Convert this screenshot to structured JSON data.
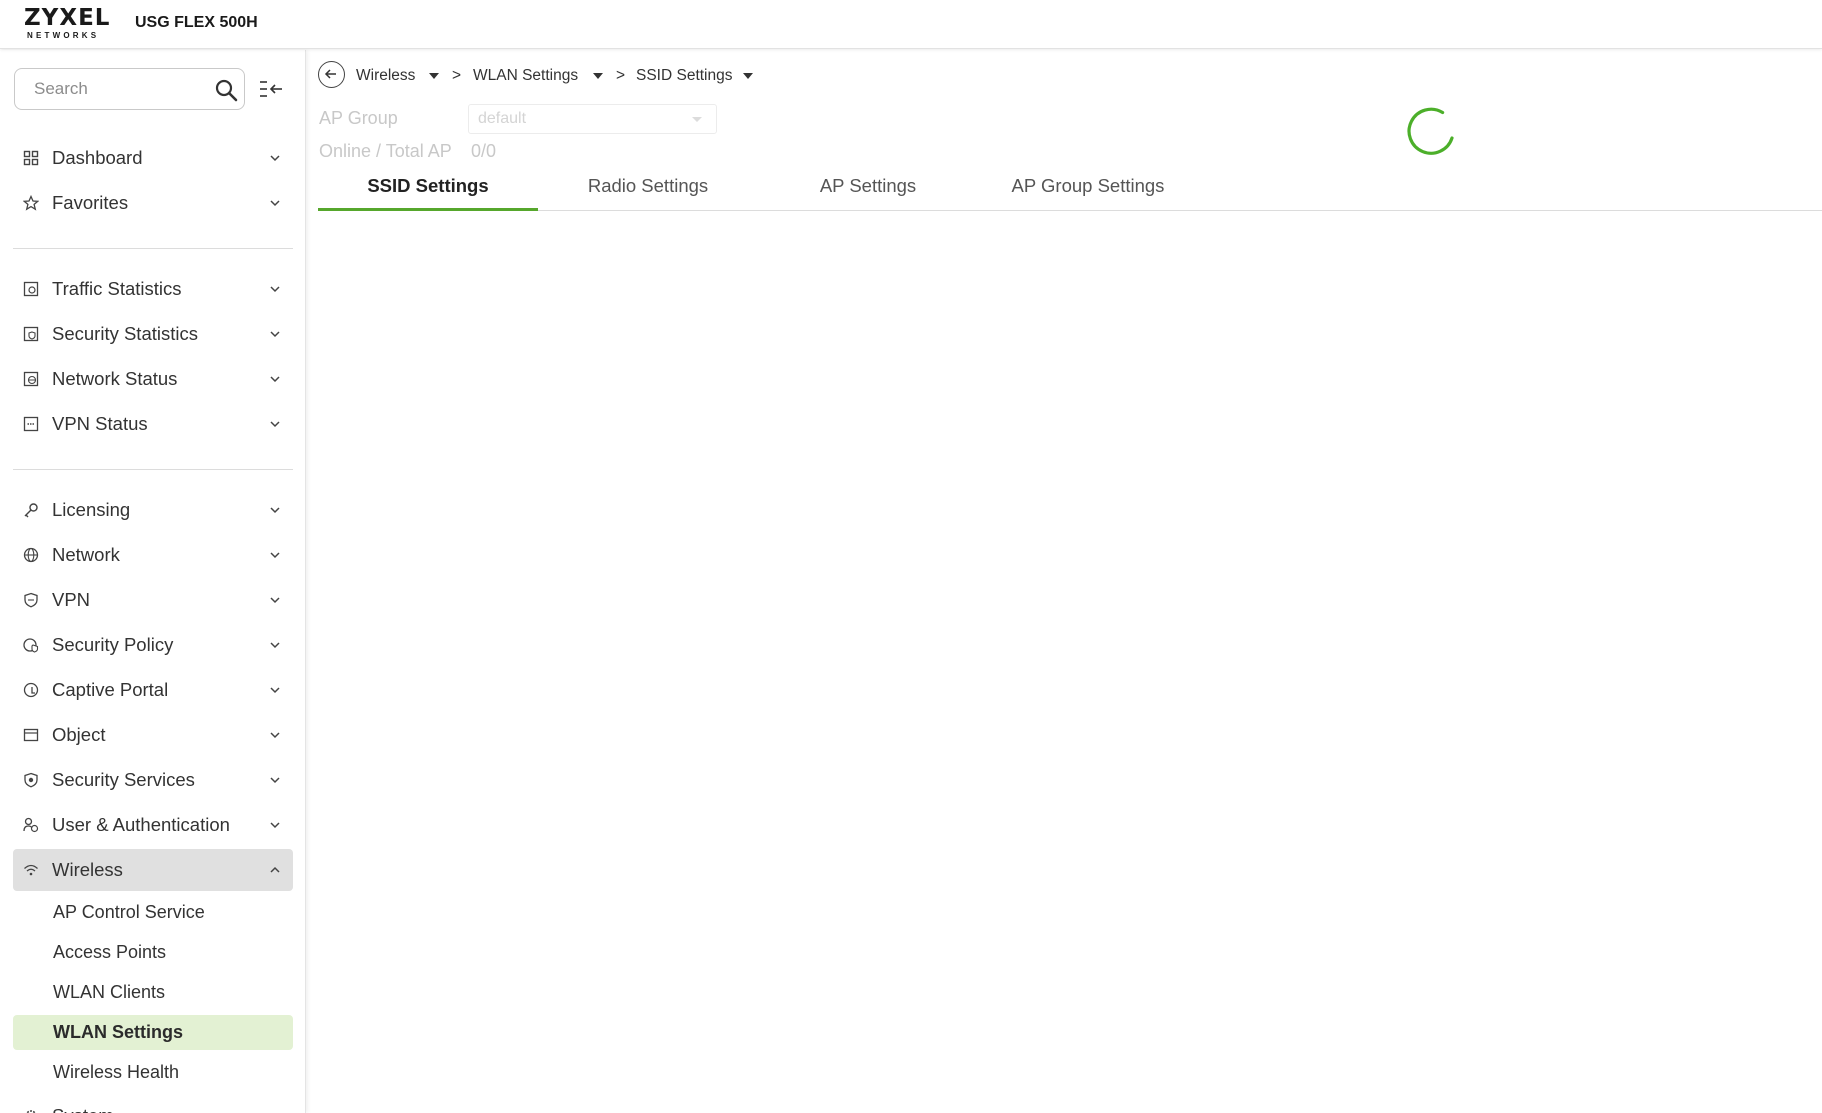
{
  "header": {
    "logo_main": "ZYXEL",
    "logo_sub": "NETWORKS",
    "product": "USG FLEX 500H"
  },
  "sidebar": {
    "search_placeholder": "Search",
    "groups": [
      [
        {
          "label": "Dashboard",
          "icon": "dashboard-icon"
        },
        {
          "label": "Favorites",
          "icon": "star-icon"
        }
      ],
      [
        {
          "label": "Traffic Statistics",
          "icon": "traffic-statistics-icon"
        },
        {
          "label": "Security Statistics",
          "icon": "security-statistics-icon"
        },
        {
          "label": "Network Status",
          "icon": "network-status-icon"
        },
        {
          "label": "VPN Status",
          "icon": "vpn-status-icon"
        }
      ],
      [
        {
          "label": "Licensing",
          "icon": "key-icon"
        },
        {
          "label": "Network",
          "icon": "globe-icon"
        },
        {
          "label": "VPN",
          "icon": "shield-icon"
        },
        {
          "label": "Security Policy",
          "icon": "security-policy-icon"
        },
        {
          "label": "Captive Portal",
          "icon": "captive-portal-icon"
        },
        {
          "label": "Object",
          "icon": "object-icon"
        },
        {
          "label": "Security Services",
          "icon": "security-services-icon"
        },
        {
          "label": "User & Authentication",
          "icon": "users-icon"
        },
        {
          "label": "Wireless",
          "icon": "wifi-icon",
          "expanded": true
        }
      ]
    ],
    "wireless_sub": [
      {
        "label": "AP Control Service"
      },
      {
        "label": "Access Points"
      },
      {
        "label": "WLAN Clients"
      },
      {
        "label": "WLAN Settings",
        "selected": true
      },
      {
        "label": "Wireless Health"
      }
    ],
    "partial_item": "System"
  },
  "breadcrumb": {
    "items": [
      "Wireless",
      "WLAN Settings",
      "SSID Settings"
    ],
    "separator": ">"
  },
  "ap_info": {
    "group_label": "AP Group",
    "group_value": "default",
    "online_label": "Online / Total AP",
    "online_value": "0/0"
  },
  "tabs": [
    {
      "label": "SSID Settings",
      "active": true
    },
    {
      "label": "Radio Settings"
    },
    {
      "label": "AP Settings"
    },
    {
      "label": "AP Group Settings"
    }
  ],
  "colors": {
    "accent": "#56a72c",
    "selected_bg": "#e3f1d3",
    "active_bg": "#e0e0e0",
    "spinner": "#4caf2a"
  }
}
